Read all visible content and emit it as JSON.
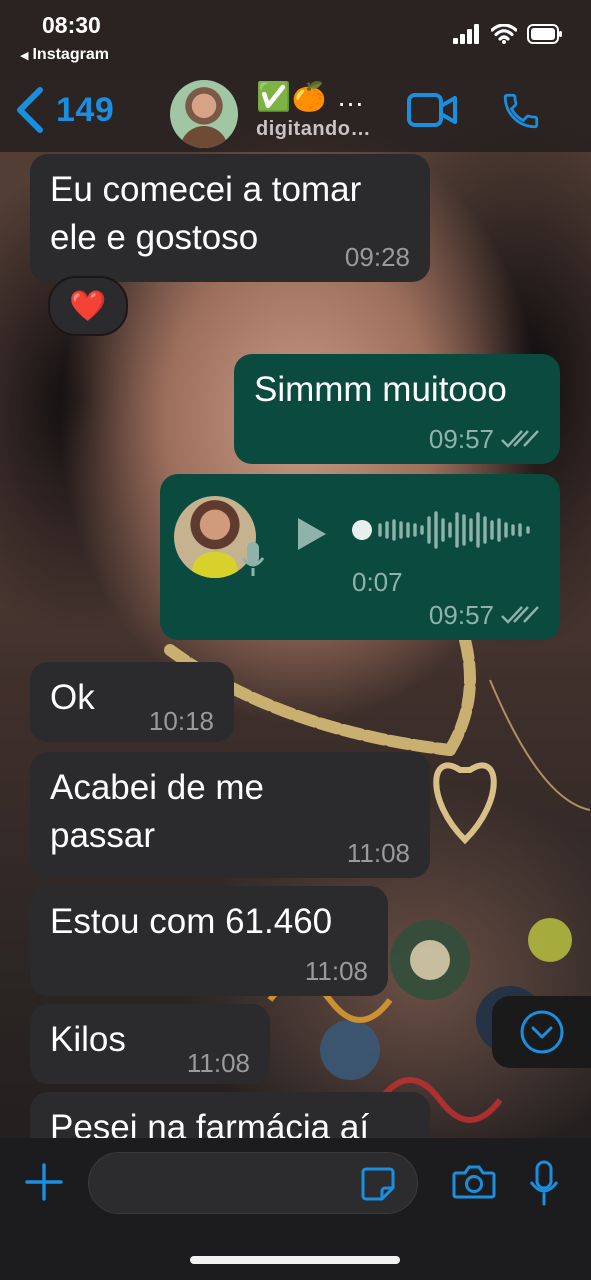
{
  "status_bar": {
    "time": "08:30",
    "back_app": "Instagram"
  },
  "header": {
    "back_count": "149",
    "contact_name": "✅🍊 …",
    "contact_status": "digitando…",
    "accent_color": "#1a8fe0"
  },
  "messages": [
    {
      "direction": "in",
      "text_lines": [
        "Eu comecei a tomar",
        "ele e  gostoso"
      ],
      "time": "09:28",
      "reaction": "❤️"
    },
    {
      "direction": "out",
      "text_lines": [
        "Simmm muitooo"
      ],
      "time": "09:57",
      "ticks": "read"
    },
    {
      "direction": "out",
      "type": "voice",
      "duration": "0:07",
      "time": "09:57",
      "ticks": "read"
    },
    {
      "direction": "in",
      "text_lines": [
        "Ok"
      ],
      "time": "10:18"
    },
    {
      "direction": "in",
      "text_lines": [
        "Acabei de me",
        "passar"
      ],
      "time": "11:08"
    },
    {
      "direction": "in",
      "text_lines": [
        "Estou com 61.460"
      ],
      "time": "11:08"
    },
    {
      "direction": "in",
      "text_lines": [
        "Kilos"
      ],
      "time": "11:08"
    },
    {
      "direction": "in",
      "text_lines": [
        "Pesei na farmácia aí"
      ],
      "time": ""
    }
  ],
  "colors": {
    "incoming_bubble": "#2b2a2d",
    "outgoing_bubble": "#0b4a3f"
  },
  "composer": {
    "placeholder": ""
  }
}
